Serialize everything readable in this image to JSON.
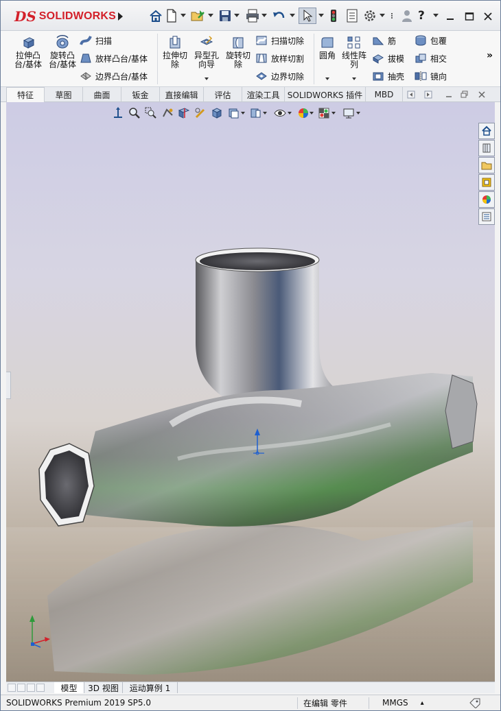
{
  "app": {
    "logo_mark": "DS",
    "logo_name": "SOLIDWORKS"
  },
  "title_icons": [
    "home-icon",
    "new-document-icon",
    "open-icon",
    "save-icon",
    "print-icon",
    "undo-icon",
    "select-cursor-icon",
    "traffic-light-icon",
    "file-properties-icon",
    "options-gear-icon",
    "overflow-icon",
    "user-icon",
    "help-icon"
  ],
  "ribbon": {
    "extrude_boss": "拉伸凸\n台/基体",
    "revolve_boss": "旋转凸\n台/基体",
    "sweep": "扫描",
    "loft_boss": "放样凸台/基体",
    "boundary_boss": "边界凸台/基体",
    "extrude_cut": "拉伸切\n除",
    "hole_wizard": "异型孔\n向导",
    "revolve_cut": "旋转切\n除",
    "sweep_cut": "扫描切除",
    "loft_cut": "放样切割",
    "boundary_cut": "边界切除",
    "fillet": "圆角",
    "linear_pattern": "线性阵\n列",
    "rib": "筋",
    "draft": "拔模",
    "shell": "抽壳",
    "wrap": "包覆",
    "intersect": "相交",
    "mirror": "镜向",
    "more": "»"
  },
  "tabs": [
    {
      "label": "特征",
      "active": true
    },
    {
      "label": "草图",
      "active": false
    },
    {
      "label": "曲面",
      "active": false
    },
    {
      "label": "钣金",
      "active": false
    },
    {
      "label": "直接编辑",
      "active": false
    },
    {
      "label": "评估",
      "active": false
    },
    {
      "label": "渲染工具",
      "active": false
    },
    {
      "label": "SOLIDWORKS 插件",
      "active": false
    },
    {
      "label": "MBD",
      "active": false
    }
  ],
  "bottom_tabs": [
    {
      "label": "模型",
      "active": true
    },
    {
      "label": "3D 视图",
      "active": false
    },
    {
      "label": "运动算例 1",
      "active": false
    }
  ],
  "status": {
    "product": "SOLIDWORKS Premium 2019 SP5.0",
    "mode": "在编辑 零件",
    "units": "MMGS",
    "units_arrow": "▴"
  },
  "colors": {
    "brand_red": "#d3202a",
    "accent_blue": "#1e6fd0"
  }
}
